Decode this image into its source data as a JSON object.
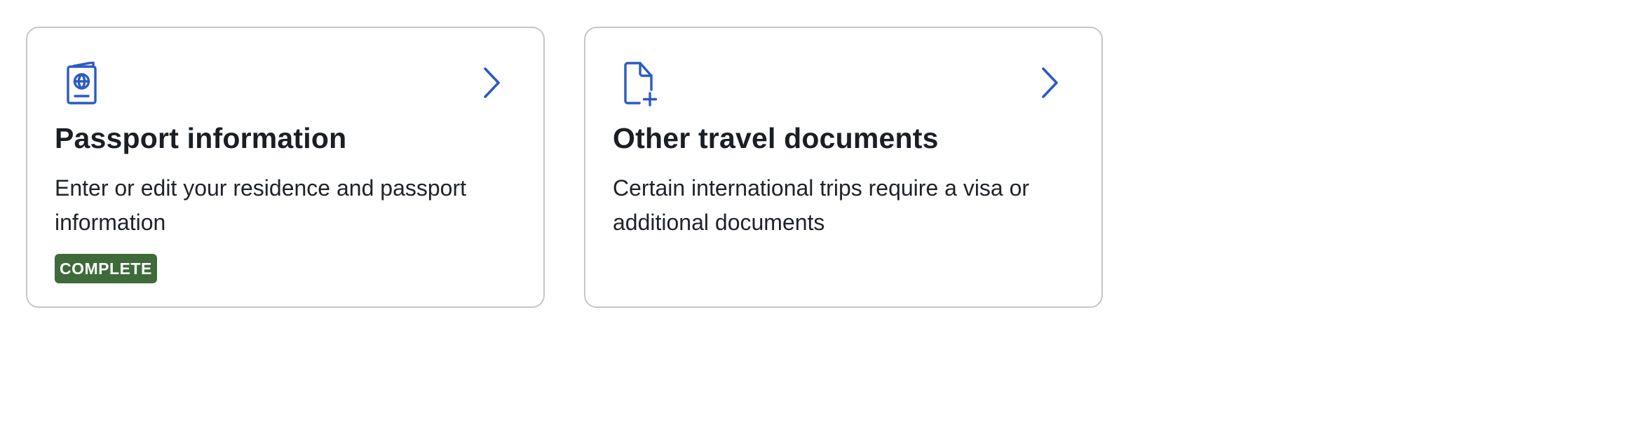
{
  "accent_color": "#2c5ac4",
  "cards": [
    {
      "icon": "passport-icon",
      "title": "Passport information",
      "description": "Enter or edit your residence and passport information",
      "badge": "COMPLETE",
      "badge_color": "#3e6b39",
      "action_icon": "chevron-right-icon"
    },
    {
      "icon": "document-add-icon",
      "title": "Other travel documents",
      "description": "Certain international trips require a visa or additional documents",
      "action_icon": "chevron-right-icon"
    }
  ]
}
